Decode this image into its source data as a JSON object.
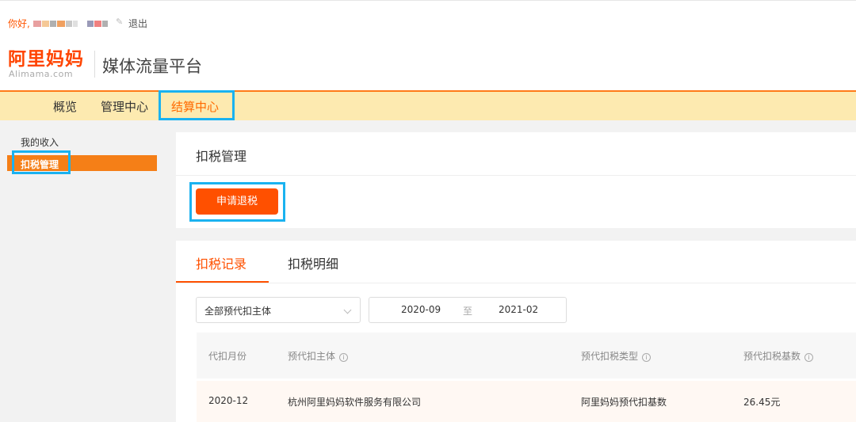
{
  "topbar": {
    "greeting": "你好,",
    "logout": "退出",
    "username_block_colors": [
      "#e8a0a0",
      "#f5c896",
      "#b0b0b0",
      "#f0a060",
      "#c8c8c8",
      "#e0e0e0",
      "#9a9ab8",
      "#f08080",
      "#b0b0b0"
    ]
  },
  "brand": {
    "logo_cn": "阿里妈妈",
    "logo_en": "Alimama.com",
    "title": "媒体流量平台"
  },
  "nav": {
    "items": [
      {
        "label": "概览"
      },
      {
        "label": "管理中心"
      },
      {
        "label": "结算中心",
        "active": true
      }
    ]
  },
  "sidebar": {
    "items": [
      {
        "label": "我的收入"
      },
      {
        "label": "扣税管理",
        "active": true
      }
    ]
  },
  "tax_card": {
    "title": "扣税管理",
    "apply_button": "申请退税"
  },
  "records": {
    "tabs": [
      {
        "label": "扣税记录",
        "active": true
      },
      {
        "label": "扣税明细"
      }
    ],
    "filter_select": "全部预代扣主体",
    "date_range": {
      "start": "2020-09",
      "to": "至",
      "end": "2021-02"
    },
    "columns": [
      "代扣月份",
      "预代扣主体",
      "预代扣税类型",
      "预代扣税基数"
    ],
    "rows": [
      [
        "2020-12",
        "杭州阿里妈妈软件服务有限公司",
        "阿里妈妈预代扣基数",
        "26.45元"
      ]
    ]
  },
  "colors": {
    "accent": "#ff5000",
    "highlight_frame": "#1ab2f0",
    "nav_bg": "#fdeab0"
  }
}
